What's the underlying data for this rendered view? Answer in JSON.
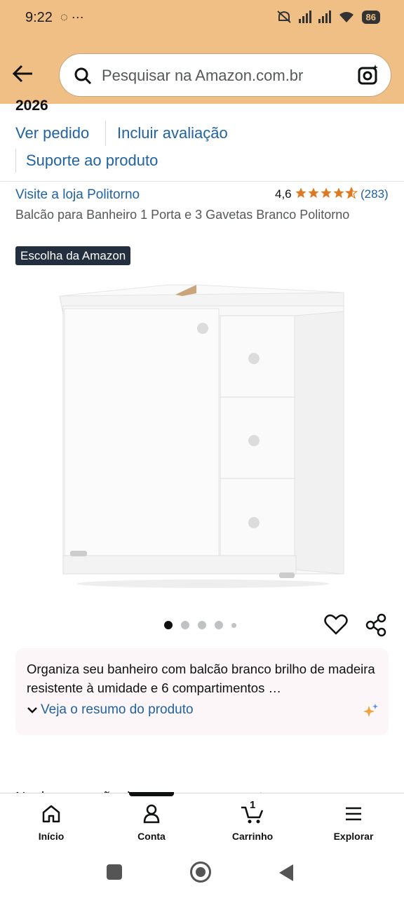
{
  "status_bar": {
    "time": "9:22",
    "notification_icons": "◌ ···",
    "battery": "86"
  },
  "search": {
    "placeholder": "Pesquisar na Amazon.com.br"
  },
  "order": {
    "year_fragment": "2026",
    "view_order": "Ver pedido",
    "add_review": "Incluir avaliação",
    "product_support": "Suporte ao produto"
  },
  "product": {
    "store_link": "Visite a loja Politorno",
    "rating": "4,6",
    "stars": 4.6,
    "rating_count": "(283)",
    "title": "Balcão para Banheiro 1 Porta e 3 Gavetas Branco Politorno",
    "badge": "Escolha da Amazon",
    "image_count": 5,
    "image_index": 1
  },
  "summary": {
    "text": "Organiza seu banheiro com balcão branco brilho de madeira resistente à umidade e 6 compartimentos …",
    "link": "Veja o resumo do produto"
  },
  "partial_text": "Nenhuma opção de compra no momento",
  "bottom_nav": {
    "home": "Início",
    "account": "Conta",
    "cart": "Carrinho",
    "cart_count": "1",
    "explore": "Explorar"
  },
  "colors": {
    "header": "#F0BF86",
    "link": "#2162A1",
    "star": "#DE7921",
    "badge": "#232F3E"
  }
}
